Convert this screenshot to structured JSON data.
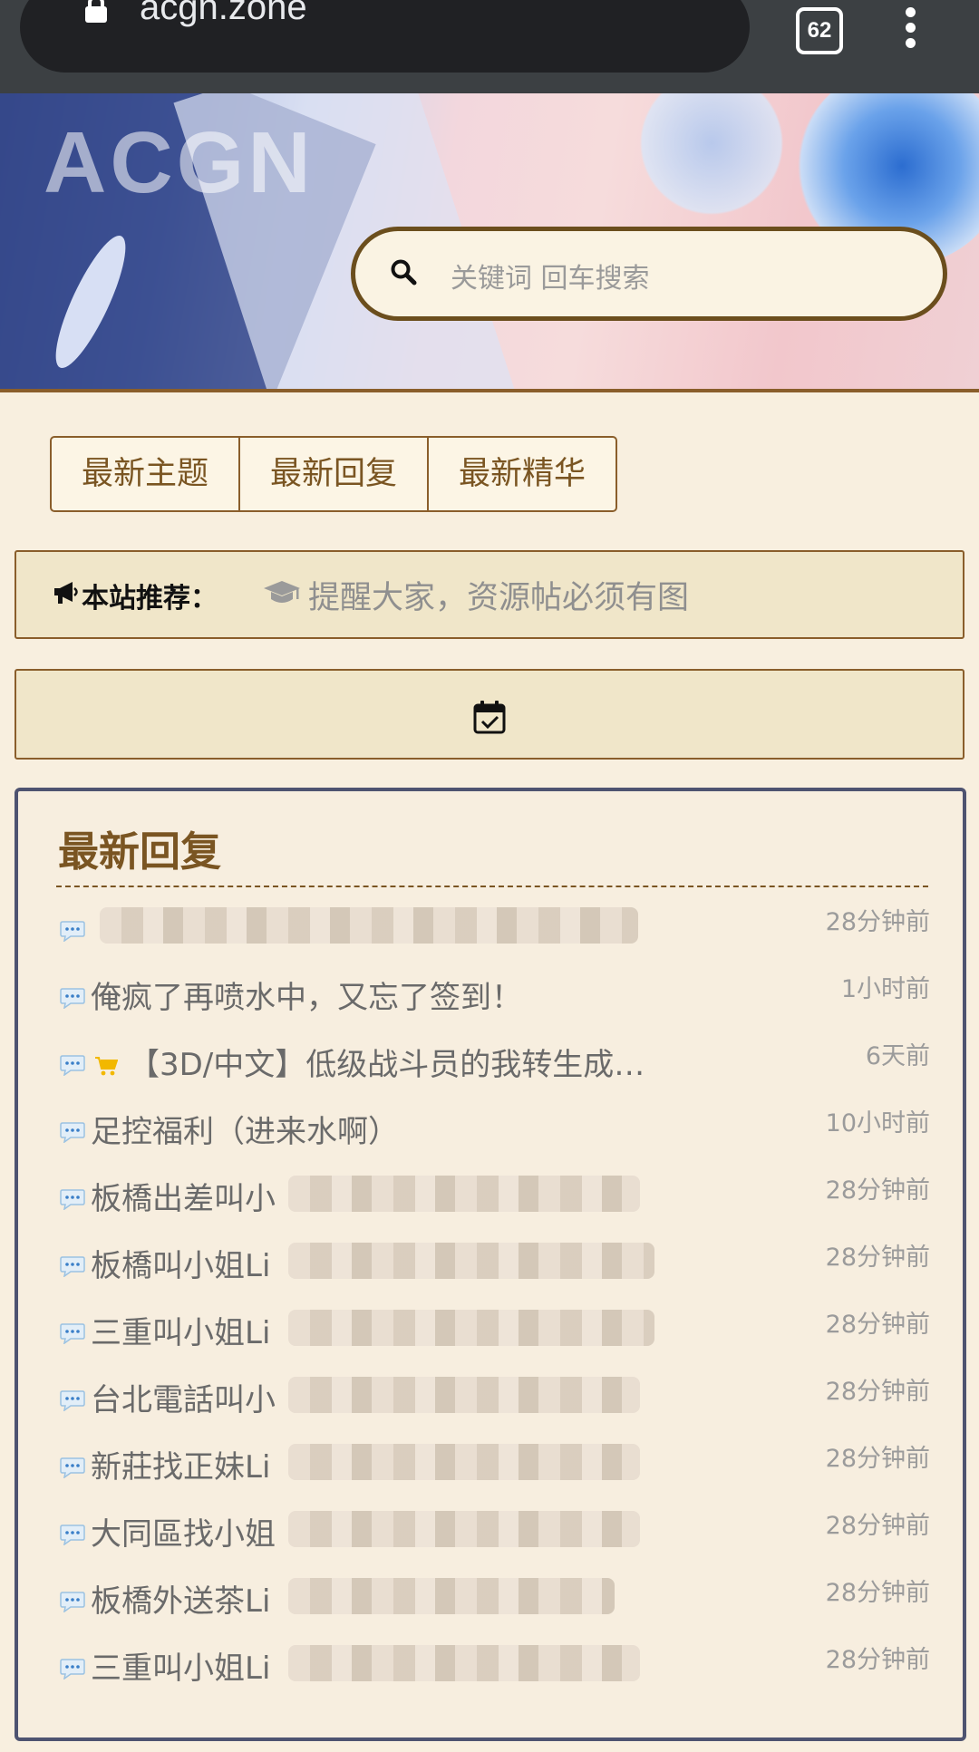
{
  "browser": {
    "url": "acgn.zone",
    "tab_count": "62"
  },
  "banner": {
    "logo_text": "ACGN"
  },
  "search": {
    "placeholder": "关键词 回车搜索"
  },
  "tabs": [
    {
      "label": "最新主题"
    },
    {
      "label": "最新回复"
    },
    {
      "label": "最新精华"
    }
  ],
  "recommend": {
    "title": "本站推荐：",
    "text": "提醒大家，资源帖必须有图"
  },
  "latest": {
    "title": "最新回复",
    "items": [
      {
        "title": "",
        "time": "28分钟前"
      },
      {
        "title": "俺疯了再喷水中，又忘了签到！",
        "time": "1小时前"
      },
      {
        "title": "【3D/中文】低级战斗员的我转生成…",
        "time": "6天前"
      },
      {
        "title": "足控福利（进来水啊）",
        "time": "10小时前"
      },
      {
        "title": "板橋出差叫小",
        "time": "28分钟前"
      },
      {
        "title": "板橋叫小姐Li",
        "time": "28分钟前"
      },
      {
        "title": "三重叫小姐Li",
        "time": "28分钟前"
      },
      {
        "title": "台北電話叫小",
        "time": "28分钟前"
      },
      {
        "title": "新莊找正妹Li",
        "time": "28分钟前"
      },
      {
        "title": "大同區找小姐",
        "time": "28分钟前"
      },
      {
        "title": "板橋外送茶Li",
        "time": "28分钟前"
      },
      {
        "title": "三重叫小姐Li",
        "time": "28分钟前"
      }
    ]
  },
  "icons": {
    "lock": "lock-icon",
    "menu": "more-vert-icon",
    "search": "search-icon",
    "megaphone": "megaphone-icon",
    "cap": "graduation-cap-icon",
    "calendar": "calendar-check-icon",
    "bubble": "comment-icon",
    "cart": "cart-icon"
  },
  "colors": {
    "accent_brown": "#7a5522",
    "panel_border": "#4e5370",
    "page_bg": "#f8efdf",
    "cart_yellow": "#f2b800"
  }
}
